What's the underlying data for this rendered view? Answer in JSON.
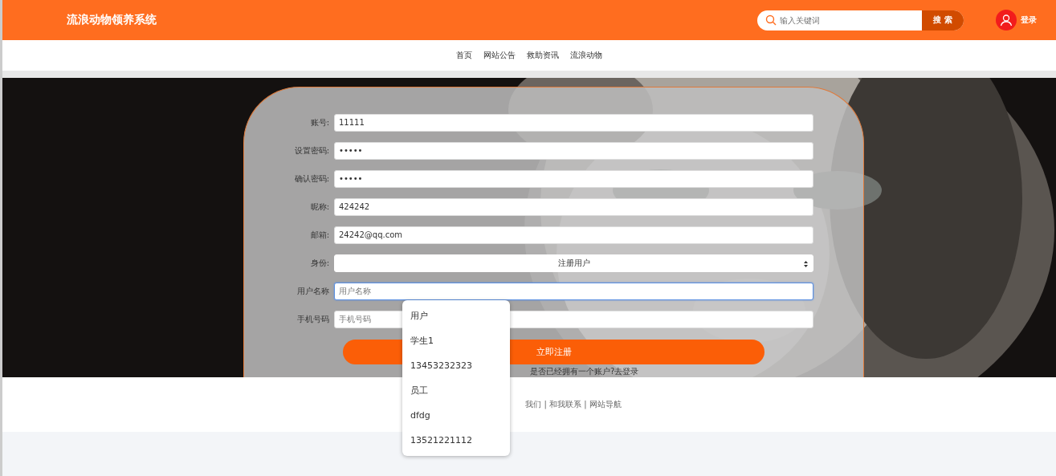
{
  "header": {
    "site_title": "流浪动物领养系统",
    "search": {
      "placeholder": "输入关键词",
      "button": "搜 索"
    },
    "login": "登录"
  },
  "nav": {
    "items": [
      {
        "label": "首页",
        "selected": false
      },
      {
        "label": "网站公告",
        "selected": false
      },
      {
        "label": "救助资讯",
        "selected": false
      },
      {
        "label": "流浪动物",
        "selected": false
      }
    ]
  },
  "form": {
    "fields": [
      {
        "label": "账号:",
        "kind": "text",
        "value": "11111",
        "focused": false
      },
      {
        "label": "设置密码:",
        "kind": "password",
        "value": "•••••",
        "focused": false
      },
      {
        "label": "确认密码:",
        "kind": "password",
        "value": "•••••",
        "focused": false
      },
      {
        "label": "昵称:",
        "kind": "text",
        "value": "424242",
        "focused": false
      },
      {
        "label": "邮箱:",
        "kind": "text",
        "value": "24242@qq.com",
        "focused": false
      },
      {
        "label": "身份:",
        "kind": "select",
        "value": "注册用户",
        "focused": false
      },
      {
        "label": "用户名称",
        "kind": "text",
        "placeholder": "用户名称",
        "focused": true,
        "suggestions": [
          "用户",
          "学生1",
          "13453232323",
          "员工",
          "dfdg",
          "13521221112"
        ]
      },
      {
        "label": "手机号码",
        "kind": "text",
        "placeholder": "手机号码",
        "focused": false
      }
    ],
    "submit": "立即注册",
    "login_link": "是否已经拥有一个账户?去登录"
  },
  "footer": {
    "links": "我们 | 和我联系 | 网站导航"
  }
}
